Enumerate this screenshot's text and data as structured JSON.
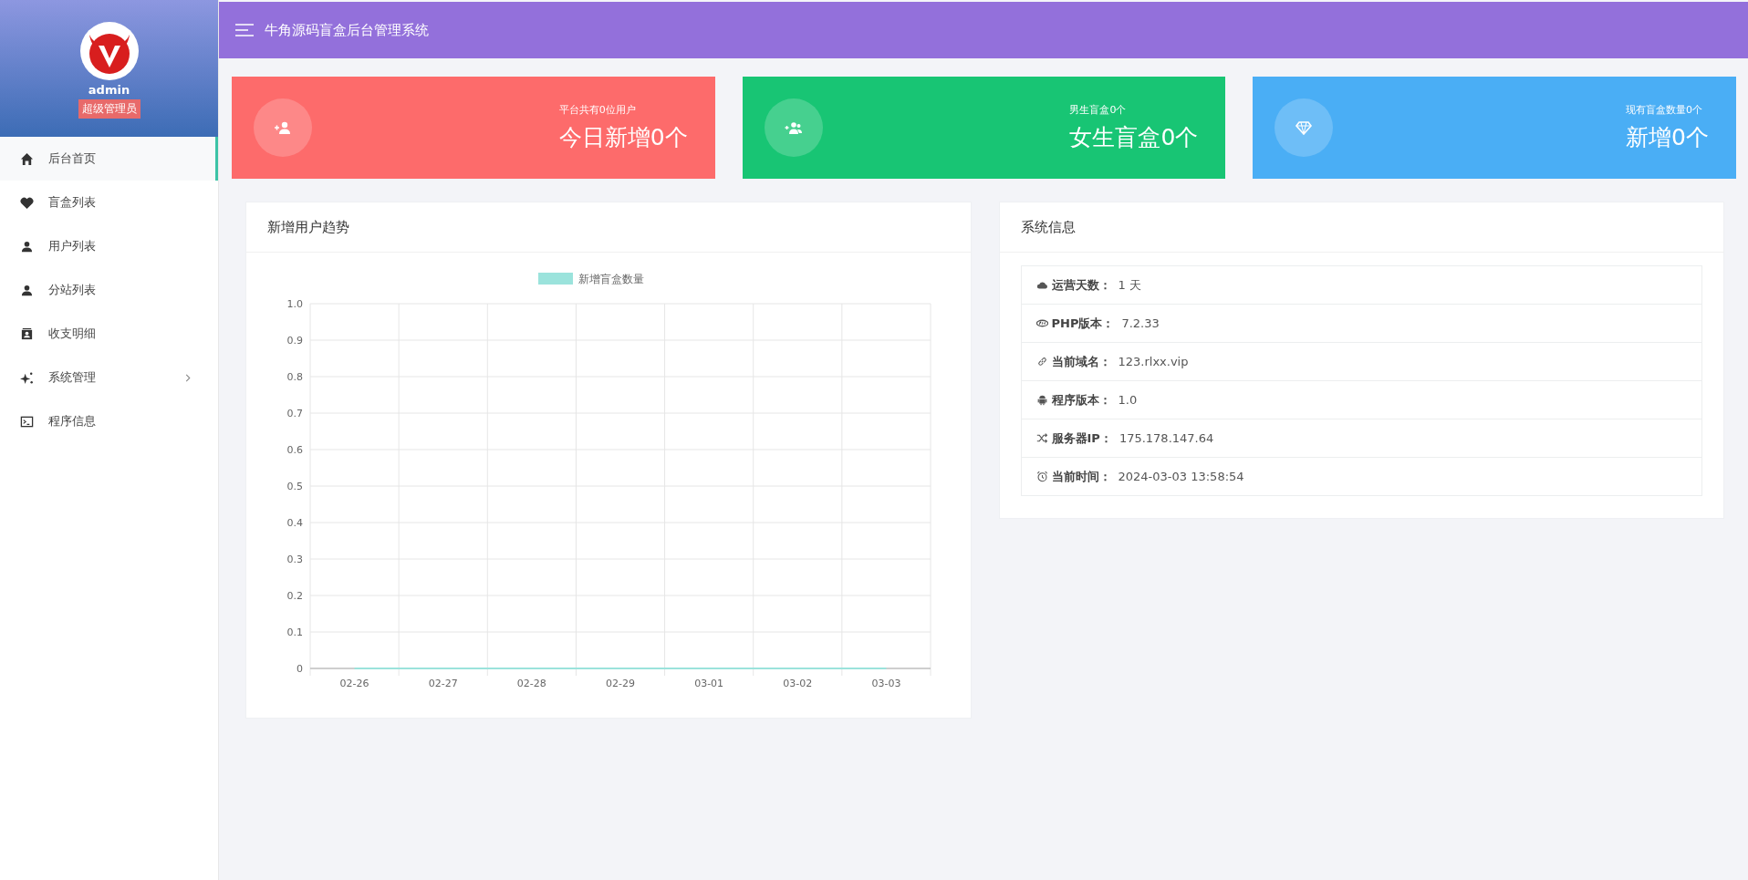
{
  "sidebar": {
    "user": {
      "name": "admin",
      "role": "超级管理员"
    },
    "items": [
      {
        "label": "后台首页",
        "selected": true,
        "submenu": false
      },
      {
        "label": "盲盒列表",
        "selected": false,
        "submenu": false
      },
      {
        "label": "用户列表",
        "selected": false,
        "submenu": false
      },
      {
        "label": "分站列表",
        "selected": false,
        "submenu": false
      },
      {
        "label": "收支明细",
        "selected": false,
        "submenu": false
      },
      {
        "label": "系统管理",
        "selected": false,
        "submenu": true
      },
      {
        "label": "程序信息",
        "selected": false,
        "submenu": false
      }
    ]
  },
  "topbar": {
    "title": "牛角源码盲盒后台管理系统"
  },
  "stat_cards": [
    {
      "caption": "平台共有0位用户",
      "value": "今日新增0个",
      "color": "#fd6b6b"
    },
    {
      "caption": "男生盲盒0个",
      "value": "女生盲盒0个",
      "color": "#18c574"
    },
    {
      "caption": "现有盲盒数量0个",
      "value": "新增0个",
      "color": "#4aaef5"
    }
  ],
  "trend_panel": {
    "title": "新增用户趋势",
    "chart_data": {
      "type": "line",
      "categories": [
        "02-26",
        "02-27",
        "02-28",
        "02-29",
        "03-01",
        "03-02",
        "03-03"
      ],
      "series": [
        {
          "name": "新增盲盒数量",
          "color": "#9be3dc",
          "values": [
            0,
            0,
            0,
            0,
            0,
            0,
            0
          ]
        }
      ],
      "ylim": [
        0,
        1
      ],
      "grid": true,
      "yticks": [
        0,
        0.1,
        0.2,
        0.3,
        0.4,
        0.5,
        0.6,
        0.7,
        0.8,
        0.9,
        {
          "value": 1,
          "label": "1.0"
        }
      ]
    }
  },
  "info_panel": {
    "title": "系统信息",
    "rows": [
      {
        "label": "运营天数：",
        "value": "1 天"
      },
      {
        "label": "PHP版本：",
        "value": "7.2.33"
      },
      {
        "label": "当前域名：",
        "value": "123.rlxx.vip"
      },
      {
        "label": "程序版本：",
        "value": "1.0"
      },
      {
        "label": "服务器IP：",
        "value": "175.178.147.64"
      },
      {
        "label": "当前时间：",
        "value": "2024-03-03 13:58:54"
      }
    ]
  }
}
